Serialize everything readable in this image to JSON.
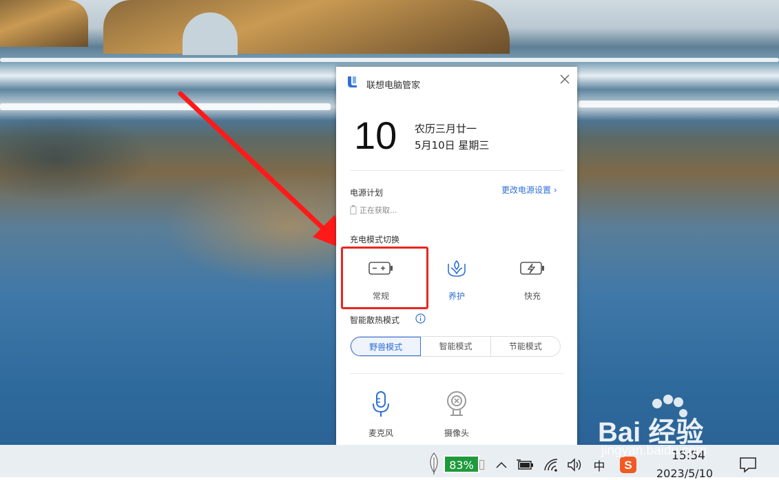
{
  "popup": {
    "app_title": "联想电脑管家",
    "day": "10",
    "lunar_date": "农历三月廿一",
    "date_line": "5月10日 星期三",
    "power_plan_label": "电源计划",
    "power_settings_link": "更改电源设置 ›",
    "power_status": "正在获取...",
    "charge_mode_label": "充电模式切换",
    "charge_modes": [
      {
        "label": "常规",
        "icon": "battery-normal-icon"
      },
      {
        "label": "养护",
        "icon": "battery-care-icon"
      },
      {
        "label": "快充",
        "icon": "battery-fast-charge-icon"
      }
    ],
    "thermal_label": "智能散热模式",
    "thermal_modes": [
      "野兽模式",
      "智能模式",
      "节能模式"
    ],
    "devices": [
      {
        "label": "麦克风",
        "icon": "microphone-icon"
      },
      {
        "label": "摄像头",
        "icon": "camera-icon"
      }
    ]
  },
  "taskbar": {
    "battery_percent": "83%",
    "ime_label": "中",
    "time": "15:54",
    "date": "2023/5/10"
  },
  "watermark": {
    "brand": "Bai 经验",
    "site": "jingyan.baidu.com"
  },
  "colors": {
    "accent": "#2f6fd6",
    "highlight": "#e8251f",
    "battery": "#1e9a3c"
  }
}
